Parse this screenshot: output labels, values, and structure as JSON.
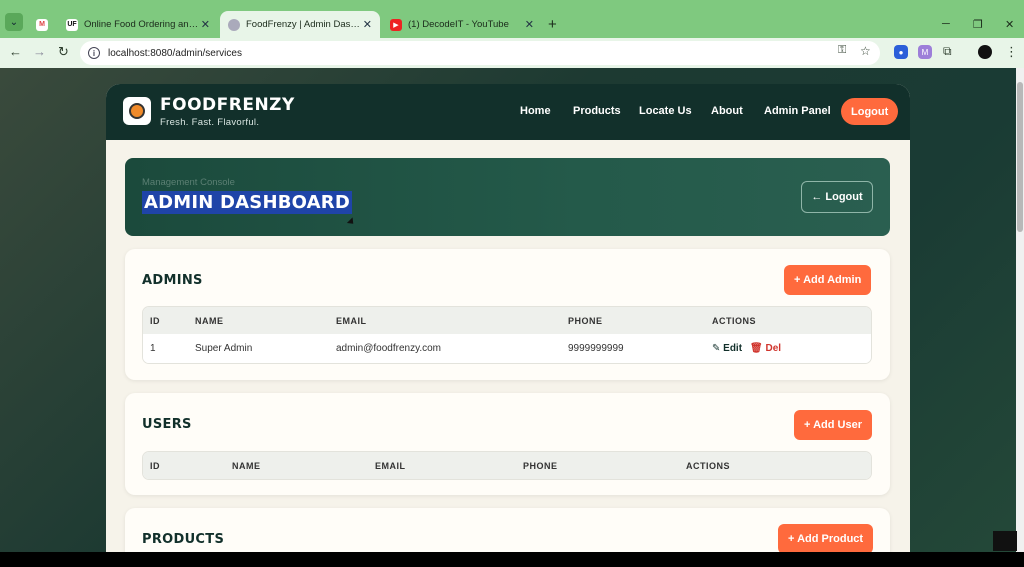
{
  "browser": {
    "tabs": [
      {
        "title": "",
        "favicon": "gmail-icon"
      },
      {
        "title": "Online Food Ordering and Rest",
        "favicon": "uf-icon"
      },
      {
        "title": "FoodFrenzy | Admin Dashboard",
        "favicon": "globe-icon"
      },
      {
        "title": "(1) DecodeIT - YouTube",
        "favicon": "youtube-icon"
      }
    ],
    "url": "localhost:8080/admin/services",
    "window_controls": {
      "minimize": "─",
      "restore": "❐",
      "close": "✕"
    }
  },
  "site": {
    "brand": "FOODFRENZY",
    "tagline": "Fresh. Fast. Flavorful.",
    "nav": [
      "Home",
      "Products",
      "Locate Us",
      "About",
      "Admin Panel"
    ],
    "nav_logout": "Logout"
  },
  "hero": {
    "kicker": "Management Console",
    "title": "ADMIN DASHBOARD",
    "logout": "← Logout"
  },
  "admins": {
    "title": "ADMINS",
    "add_label": "+ Add Admin",
    "columns": [
      "ID",
      "NAME",
      "EMAIL",
      "PHONE",
      "ACTIONS"
    ],
    "rows": [
      {
        "id": "1",
        "name": "Super Admin",
        "email": "admin@foodfrenzy.com",
        "phone": "9999999999"
      }
    ],
    "edit_label": "✎ Edit",
    "del_label": "🗑 Del"
  },
  "users": {
    "title": "USERS",
    "add_label": "+ Add User",
    "columns": [
      "ID",
      "NAME",
      "EMAIL",
      "PHONE",
      "ACTIONS"
    ]
  },
  "products": {
    "title": "PRODUCTS",
    "add_label": "+ Add Product"
  },
  "colors": {
    "accent": "#ff6a3d",
    "header": "#12302b",
    "chrome": "#7fc97f"
  }
}
